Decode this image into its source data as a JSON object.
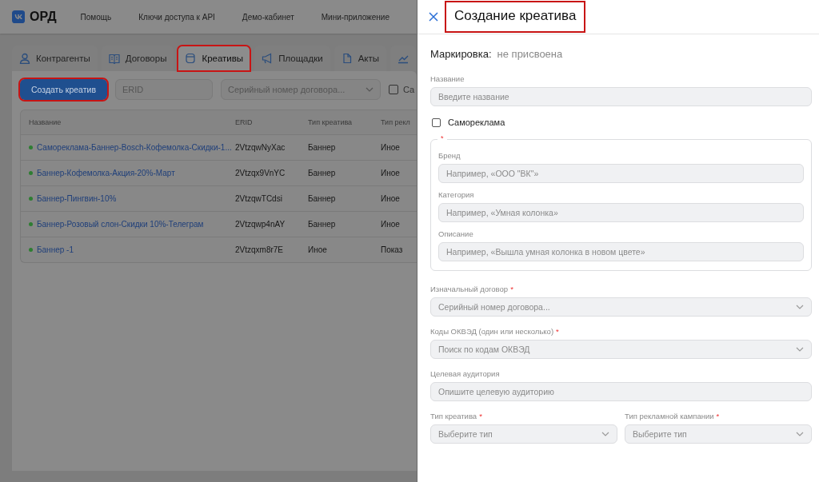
{
  "header": {
    "logo_text": "ОРД",
    "nav": [
      "Помощь",
      "Ключи доступа к API",
      "Демо-кабинет",
      "Мини-приложение"
    ]
  },
  "tabs": [
    {
      "label": "Контрагенты",
      "selected": false,
      "highlighted": false
    },
    {
      "label": "Договоры",
      "selected": false,
      "highlighted": false
    },
    {
      "label": "Креативы",
      "selected": true,
      "highlighted": true
    },
    {
      "label": "Площадки",
      "selected": false,
      "highlighted": false
    },
    {
      "label": "Акты",
      "selected": false,
      "highlighted": false
    },
    {
      "selected": false,
      "highlighted": false
    }
  ],
  "toolbar": {
    "create_button": {
      "label": "Создать креатив",
      "highlighted": true
    },
    "erid_placeholder": "ERID",
    "contract_placeholder": "Серийный номер договора...",
    "checkbox": {
      "label": "Са",
      "checked": false
    }
  },
  "table": {
    "columns": [
      "Название",
      "ERID",
      "Тип креатива",
      "Тип рекл"
    ],
    "rows": [
      {
        "name": "Самореклама-Баннер-Bosch-Кофемолка-Скидки-1...",
        "erid": "2VtzqwNyXac",
        "type": "Баннер",
        "column_4": "Иное",
        "color": "#2e7d32"
      },
      {
        "name": "Баннер-Кофемолка-Акция-20%-Март",
        "erid": "2Vtzqx9VnYC",
        "type": "Баннер",
        "column_4": "Иное",
        "color": "#2e7d32"
      },
      {
        "name": "Баннер-Пингвин-10%",
        "erid": "2VtzqwTCdsi",
        "type": "Баннер",
        "column_4": "Иное",
        "color": "#2e7d32"
      },
      {
        "name": "Баннер-Розовый слон-Скидки 10%-Телеграм",
        "erid": "2Vtzqwp4nAY",
        "type": "Баннер",
        "column_4": "Иное",
        "color": "#2e7d32"
      },
      {
        "name": "Баннер -1",
        "erid": "2Vtzqxm8r7E",
        "type": "Иное",
        "column_4": "Показ",
        "color": "#2e7d32"
      }
    ]
  },
  "panel": {
    "title": "Создание креатива",
    "title_highlighted": true,
    "marking_label": "Маркировка:",
    "marking_value": "не присвоена",
    "name_field": {
      "label": "Название",
      "placeholder": "Введите название"
    },
    "self_ad": {
      "label": "Самореклама",
      "checked": false
    },
    "group": {
      "required": "*",
      "fields": [
        {
          "label": "Бренд",
          "placeholder": "Например, «ООО \"ВК\"»"
        },
        {
          "label": "Категория",
          "placeholder": "Например,  «Умная колонка»"
        },
        {
          "label": "Описание",
          "placeholder": "Например, «Вышла умная колонка в новом цвете»"
        }
      ]
    },
    "fields": [
      {
        "kind": "select",
        "label": "Изначальный договор",
        "required": "*",
        "placeholder": "Серийный номер договора..."
      },
      {
        "kind": "select",
        "label": "Коды ОКВЭД (один или несколько)",
        "required": "*",
        "placeholder": "Поиск по кодам ОКВЭД"
      },
      {
        "kind": "input",
        "label": "Целевая аудитория",
        "placeholder": "Опишите целевую аудиторию"
      }
    ],
    "pair": [
      {
        "kind": "select",
        "label": "Тип креатива",
        "required": "*",
        "placeholder": "Выберите тип"
      },
      {
        "kind": "select",
        "label": "Тип рекламной кампании",
        "required": "*",
        "placeholder": "Выберите тип"
      }
    ]
  }
}
